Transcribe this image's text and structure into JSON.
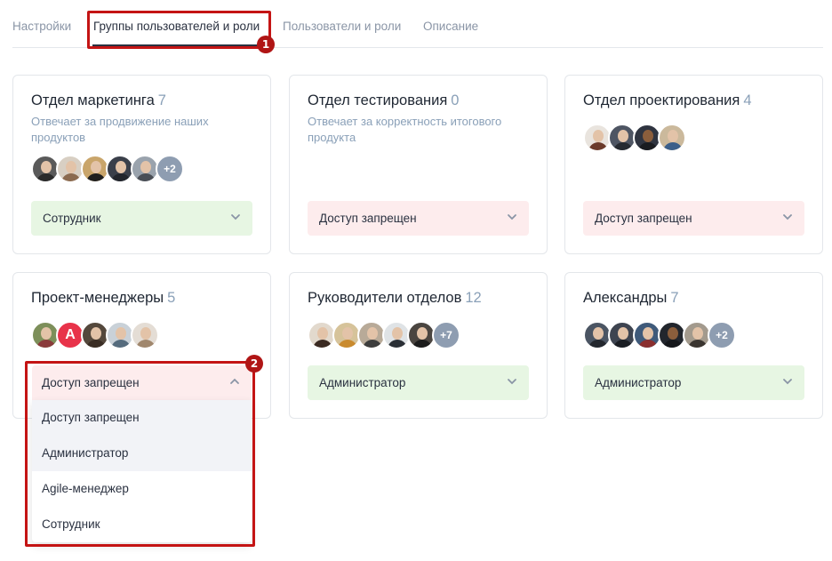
{
  "tabs": [
    {
      "label": "Настройки",
      "active": false
    },
    {
      "label": "Группы пользователей и роли",
      "active": true
    },
    {
      "label": "Пользователи и роли",
      "active": false
    },
    {
      "label": "Описание",
      "active": false
    }
  ],
  "cards": [
    {
      "title": "Отдел маркетинга",
      "count": "7",
      "description": "Отвечает за продвижение наших продуктов",
      "more": "+2",
      "role": "Сотрудник",
      "role_color": "#e7f6e3"
    },
    {
      "title": "Отдел тестирования",
      "count": "0",
      "description": "Отвечает за корректность итогового продукта",
      "role": "Доступ запрещен",
      "role_color": "#fdeced"
    },
    {
      "title": "Отдел проектирования",
      "count": "4",
      "description": "",
      "role": "Доступ запрещен",
      "role_color": "#fdeced"
    },
    {
      "title": "Проект-менеджеры",
      "count": "5",
      "description": "",
      "avatar_letter": "A",
      "role": "Доступ запрещен",
      "role_color": "#fdeced"
    },
    {
      "title": "Руководители отделов",
      "count": "12",
      "description": "",
      "more": "+7",
      "role": "Администратор",
      "role_color": "#e7f6e3"
    },
    {
      "title": "Александры",
      "count": "7",
      "description": "",
      "more": "+2",
      "role": "Администратор",
      "role_color": "#e7f6e3"
    }
  ],
  "dropdown": {
    "options": [
      "Доступ запрещен",
      "Администратор",
      "Agile-менеджер",
      "Сотрудник"
    ]
  },
  "annotations": {
    "badge1": "1",
    "badge2": "2",
    "highlight_color": "#c41414"
  },
  "icons": {
    "chevron_down": "chevron-down-icon",
    "chevron_up": "chevron-up-icon"
  }
}
